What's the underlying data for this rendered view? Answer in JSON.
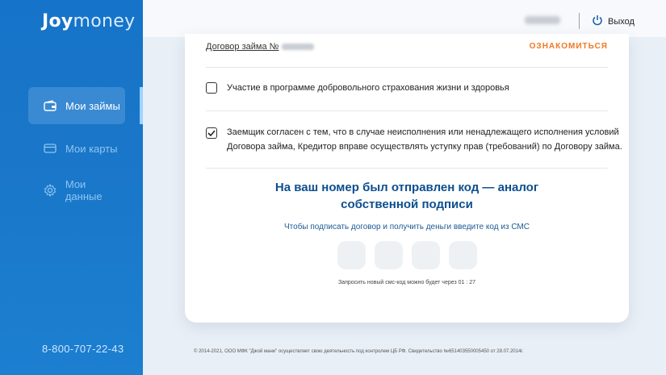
{
  "brand": {
    "logo_part1": "Joy",
    "logo_part2": "money"
  },
  "sidebar": {
    "items": [
      {
        "label": "Мои займы",
        "icon": "wallet-icon",
        "active": true
      },
      {
        "label": "Мои карты",
        "icon": "card-icon",
        "active": false
      },
      {
        "label": "Мои данные",
        "icon": "gear-icon",
        "active": false
      }
    ],
    "phone": "8-800-707-22-43"
  },
  "topbar": {
    "logout_label": "Выход"
  },
  "card": {
    "doc_label": "Договор займа №",
    "acquaint_label": "ОЗНАКОМИТЬСЯ",
    "insurance_label": "Участие в программе добровольного страхования жизни и здоровья",
    "insurance_checked": false,
    "assignment_label_1": "Заемщик согласен с тем, что в случае неисполнения или ненадлежащего исполнения условий",
    "assignment_label_2": "Договора займа, Кредитор вправе осуществлять уступку прав (требований) по Договору займа.",
    "assignment_checked": true,
    "code_title_1": "На ваш номер был отправлен код — аналог",
    "code_title_2": "собственной подписи",
    "code_subtitle": "Чтобы подписать договор и получить деньги введите код из СМС",
    "resend_text": "Запросить новый смс-код можно будет через 01 : 27"
  },
  "footer": {
    "text": "© 2014-2021, ООО МФК \"Джой мани\" осуществляет свою деятельность под контролем ЦБ РФ. Свидетельство №651403550005450 от 28.07.2014г."
  },
  "colors": {
    "sidebar": "#1a76c8",
    "accent": "#f07822",
    "title": "#0d4f8f"
  }
}
